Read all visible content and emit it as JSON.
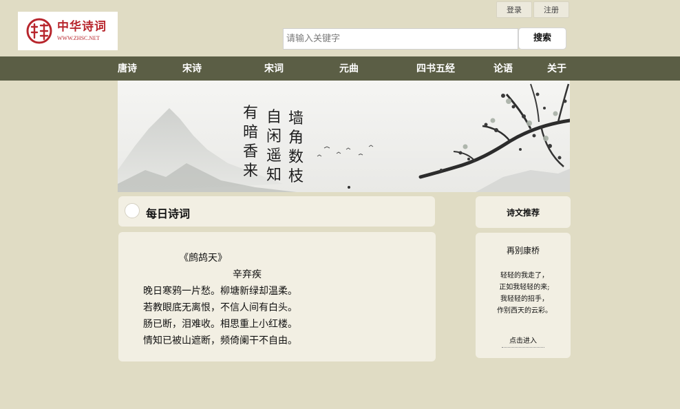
{
  "header": {
    "logo": {
      "name_cn": "中华诗词",
      "name_en": "WWW.ZHSC.NET"
    },
    "auth": {
      "login_label": "登录",
      "register_label": "注册"
    },
    "search": {
      "placeholder": "请输入关键字",
      "value": "",
      "button_label": "搜索"
    }
  },
  "nav": {
    "items": [
      {
        "label": "唐诗"
      },
      {
        "label": "宋诗"
      },
      {
        "label": "宋词"
      },
      {
        "label": "元曲"
      },
      {
        "label": "四书五经"
      },
      {
        "label": "论语"
      },
      {
        "label": "关于"
      }
    ]
  },
  "banner": {
    "calligraphy": [
      "墙角数枝",
      "自闲遥知",
      "有暗香来"
    ]
  },
  "daily": {
    "section_title": "每日诗词",
    "poem": {
      "title": "《鹧鸪天》",
      "author": "辛弃疾",
      "lines": [
        "晚日寒鸦一片愁。柳塘新绿却温柔。",
        "若教眼底无离恨，不信人间有白头。",
        "肠已断，泪难收。相思重上小红楼。",
        "情知已被山遮断，频倚阑干不自由。"
      ]
    }
  },
  "recommend": {
    "section_title": "诗文推荐",
    "poem": {
      "title": "再别康桥",
      "lines": [
        "轻轻的我走了，",
        "正如我轻轻的来;",
        "我轻轻的招手，",
        "作别西天的云彩。"
      ],
      "link_label": "点击进入"
    }
  },
  "colors": {
    "page_bg": "#e0dcc4",
    "nav_bg": "#5b5e45",
    "card_bg": "#f2efe3",
    "logo_red": "#b7252c"
  }
}
